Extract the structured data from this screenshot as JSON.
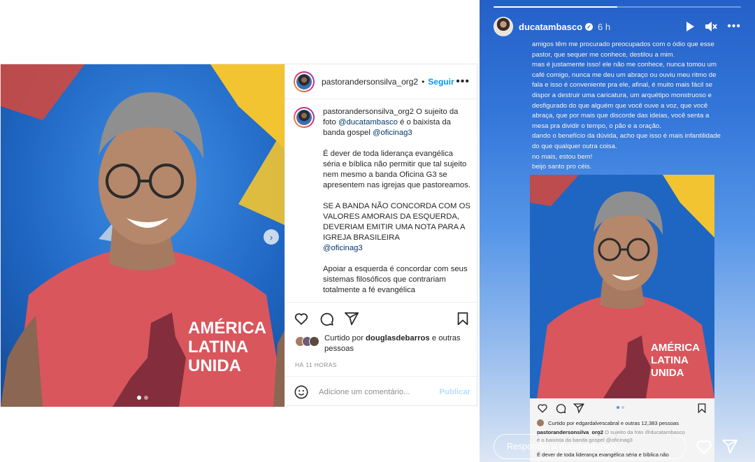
{
  "post": {
    "username": "pastorandersonsilva_org2",
    "separator": "•",
    "follow_label": "Seguir",
    "more_icon": "more-horizontal-icon",
    "caption": {
      "username": "pastorandersonsilva_org2",
      "p1_text_a": "O sujeito da foto",
      "p1_mention_a": "@ducatambasco",
      "p1_text_b": "é o baixista da banda gospel",
      "p1_mention_b": "@oficinag3",
      "p2": "É dever de toda liderança evangélica séria e bíblica não permitir que tal sujeito nem mesmo a banda Oficina G3 se apresentem nas igrejas que pastoreamos.",
      "p3": "SE A BANDA NÃO CONCORDA COM OS VALORES AMORAIS DA ESQUERDA, DEVERIAM EMITIR UMA NOTA PARA A IGREJA BRASILEIRA",
      "p3_mention": "@oficinag3",
      "p4": "Apoiar a esquerda é concordar com seus sistemas filosóficos que contrariam totalmente a fé evangélica"
    },
    "liked_prefix": "Curtido por",
    "liked_user": "douglasdebarros",
    "liked_suffix": "e outras pessoas",
    "timestamp": "HÁ 11 HORAS",
    "comment_placeholder": "Adicione um comentário...",
    "publish_label": "Publicar",
    "shirt_text": [
      "AMÉRICA",
      "LATINA",
      "UNIDA"
    ]
  },
  "story": {
    "username": "ducatambasco",
    "time": "6 h",
    "progress": 0.5,
    "text_lines": [
      "amigos têm me procurado preocupados com o ódio que esse",
      "pastor, que sequer me conhece, destilou a mim.",
      "mas é justamente isso! ele não me conhece, nunca tomou um",
      "café comigo, nunca me deu um abraço ou ouviu meu ritmo de",
      "fala e isso é conveniente pra ele, afinal, é muito mais fácil se",
      "dispor a destruir uma caricatura, um arquétipo monstruoso e",
      "desfigurado do que alguém que você ouve a voz, que você",
      "abraça, que por mais que discorde das ideias, você senta a",
      "mesa pra dividir o tempo, o pão e a oração.",
      "dando o benefício da dúvida, acho que isso é mais infantilidade",
      "do que qualquer outra coisa.",
      "no mais, estou bem!",
      "beijo santo pro céis."
    ],
    "shared_post": {
      "liked_line": "Curtido por edgardalvescabral e outras 12,383 pessoas",
      "caption_user": "pastorandersonsilva_org2",
      "caption_line1": "O sujeito da foto @ducatambasco",
      "caption_line2": "é o baixista da banda gospel @oficinag3",
      "caption_line3": "É dever de toda liderança evangélica séria e bíblica não"
    },
    "reply_placeholder": "Responder a ducatambasco..."
  }
}
